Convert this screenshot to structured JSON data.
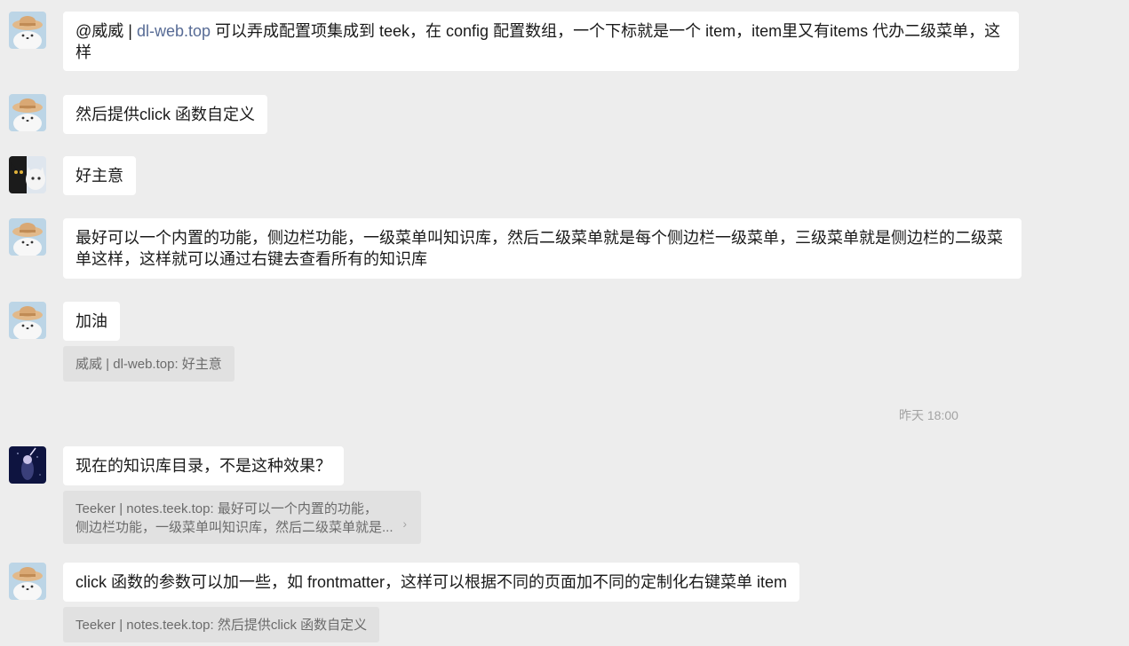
{
  "messages": [
    {
      "id": "m1",
      "avatar": "cartoon-hat-avatar",
      "text_prefix": "@威威 | ",
      "text_link": "dl-web.top",
      "text_rest": " 可以弄成配置项集成到 teek，在 config 配置数组，一个下标就是一个 item，item里又有items 代办二级菜单，这样"
    },
    {
      "id": "m2",
      "avatar": "cartoon-hat-avatar",
      "text": "然后提供click 函数自定义"
    },
    {
      "id": "m3",
      "avatar": "black-cat-avatar",
      "text": "好主意"
    },
    {
      "id": "m4",
      "avatar": "cartoon-hat-avatar",
      "text": "最好可以一个内置的功能，侧边栏功能，一级菜单叫知识库，然后二级菜单就是每个侧边栏一级菜单，三级菜单就是侧边栏的二级菜单这样，这样就可以通过右键去查看所有的知识库"
    },
    {
      "id": "m5",
      "avatar": "cartoon-hat-avatar",
      "text": "加油",
      "quote": "威威 | dl-web.top: 好主意"
    },
    {
      "id": "m6",
      "avatar": "night-figure-avatar",
      "text": "现在的知识库目录，不是这种效果？",
      "quote_line1": "Teeker | notes.teek.top: 最好可以一个内置的功能，",
      "quote_line2": "侧边栏功能，一级菜单叫知识库，然后二级菜单就是..."
    },
    {
      "id": "m7",
      "avatar": "cartoon-hat-avatar",
      "text": "click 函数的参数可以加一些，如 frontmatter，这样可以根据不同的页面加不同的定制化右键菜单 item",
      "quote": "Teeker | notes.teek.top: 然后提供click 函数自定义"
    }
  ],
  "timestamp": "昨天 18:00",
  "colors": {
    "background": "#ededed",
    "bubble": "#ffffff",
    "quote": "#e1e1e1",
    "link": "#576b95",
    "muted_text": "#a3a3a3"
  }
}
